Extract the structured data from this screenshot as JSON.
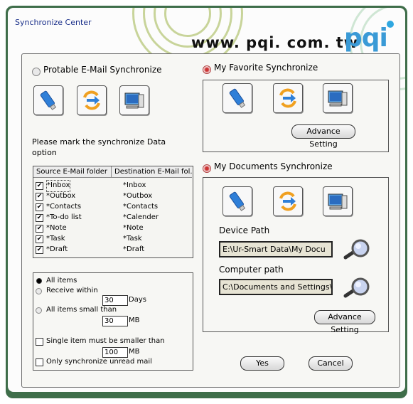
{
  "window": {
    "title": "Synchronize  Center",
    "url_text": "www. pqi. com. tw",
    "logo_text": "pqi"
  },
  "email_sync": {
    "label": "Protable E-Mail Synchronize",
    "instruction_line1": "Please mark the synchronize Data",
    "instruction_line2": "option",
    "columns": [
      "Source E-Mail folder",
      "Destination E-Mail fol..."
    ],
    "rows": [
      {
        "source": "*Inbox",
        "dest": "*Inbox"
      },
      {
        "source": "*Outbox",
        "dest": "*Outbox"
      },
      {
        "source": "*Contacts",
        "dest": "*Contacts"
      },
      {
        "source": "*To-do list",
        "dest": "*Calender"
      },
      {
        "source": "*Note",
        "dest": "*Note"
      },
      {
        "source": "*Task",
        "dest": "*Task"
      },
      {
        "source": "*Draft",
        "dest": "*Draft"
      }
    ],
    "options": {
      "all_items": "All items",
      "receive_within": "Receive within",
      "days_value": "30",
      "days_unit": "Days",
      "small_than": "All items small than",
      "small_value": "30",
      "small_unit": "MB",
      "single_item": "Single item must be smaller than",
      "single_value": "100",
      "single_unit": "MB",
      "unread_only": "Only synchronize unread mail"
    }
  },
  "favorite_sync": {
    "label": "My Favorite Synchronize",
    "advance_button": "Advance Setting"
  },
  "documents_sync": {
    "label": "My Documents Synchronize",
    "device_path_label": "Device Path",
    "device_path_value": "E:\\Ur-Smart Data\\My Docu",
    "computer_path_label": "Computer path",
    "computer_path_value": "C:\\Documents and Settings\\",
    "advance_button": "Advance Setting"
  },
  "buttons": {
    "yes": "Yes",
    "cancel": "Cancel"
  },
  "colors": {
    "frame": "#3f6e4a",
    "title_text": "#1a2f8a",
    "logo": "#3a9ad6",
    "radio_selected": "#c33333"
  }
}
